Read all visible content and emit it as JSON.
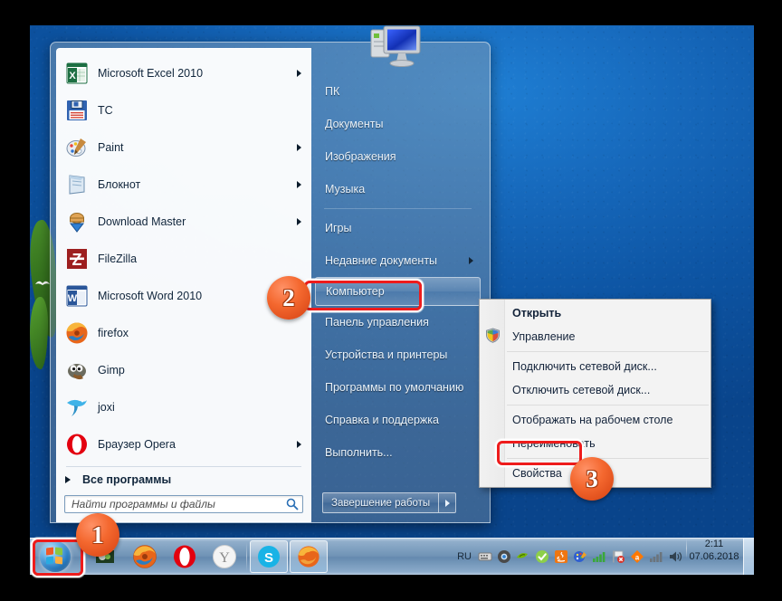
{
  "desktop": {
    "wallpaper_color": "#1668bb"
  },
  "start_menu": {
    "user_picture": "computer-monitor-icon",
    "programs": [
      {
        "label": "Microsoft Excel 2010",
        "icon": "excel-icon",
        "has_submenu": true
      },
      {
        "label": "TC",
        "icon": "total-commander-icon",
        "has_submenu": false
      },
      {
        "label": "Paint",
        "icon": "paint-icon",
        "has_submenu": true
      },
      {
        "label": "Блокнот",
        "icon": "notepad-icon",
        "has_submenu": true
      },
      {
        "label": "Download Master",
        "icon": "download-master-icon",
        "has_submenu": true
      },
      {
        "label": "FileZilla",
        "icon": "filezilla-icon",
        "has_submenu": false
      },
      {
        "label": "Microsoft Word 2010",
        "icon": "word-icon",
        "has_submenu": false
      },
      {
        "label": "firefox",
        "icon": "firefox-icon",
        "has_submenu": false
      },
      {
        "label": "Gimp",
        "icon": "gimp-icon",
        "has_submenu": false
      },
      {
        "label": "joxi",
        "icon": "joxi-icon",
        "has_submenu": false
      },
      {
        "label": "Браузер Opera",
        "icon": "opera-icon",
        "has_submenu": true
      }
    ],
    "all_programs_label": "Все программы",
    "search": {
      "placeholder": "Найти программы и файлы",
      "value": "",
      "icon": "search-icon"
    },
    "right_items": [
      {
        "label": "ПК",
        "has_submenu": false,
        "selected": false,
        "divider_after": false
      },
      {
        "label": "Документы",
        "has_submenu": false,
        "selected": false,
        "divider_after": false
      },
      {
        "label": "Изображения",
        "has_submenu": false,
        "selected": false,
        "divider_after": false
      },
      {
        "label": "Музыка",
        "has_submenu": false,
        "selected": false,
        "divider_after": true
      },
      {
        "label": "Игры",
        "has_submenu": false,
        "selected": false,
        "divider_after": false
      },
      {
        "label": "Недавние документы",
        "has_submenu": true,
        "selected": false,
        "divider_after": false
      },
      {
        "label": "Компьютер",
        "has_submenu": false,
        "selected": true,
        "divider_after": false
      },
      {
        "label": "Панель управления",
        "has_submenu": false,
        "selected": false,
        "divider_after": false
      },
      {
        "label": "Устройства и принтеры",
        "has_submenu": false,
        "selected": false,
        "divider_after": false
      },
      {
        "label": "Программы по умолчанию",
        "has_submenu": false,
        "selected": false,
        "divider_after": false
      },
      {
        "label": "Справка и поддержка",
        "has_submenu": false,
        "selected": false,
        "divider_after": false
      },
      {
        "label": "Выполнить...",
        "has_submenu": false,
        "selected": false,
        "divider_after": false
      }
    ],
    "shutdown": {
      "label": "Завершение работы",
      "more_icon": "chevron-right-icon"
    }
  },
  "context_menu": {
    "items": [
      {
        "label": "Открыть",
        "bold": true,
        "sep_after": false
      },
      {
        "label": "Управление",
        "bold": false,
        "sep_after": true,
        "shield": true
      },
      {
        "label": "Подключить сетевой диск...",
        "bold": false,
        "sep_after": false
      },
      {
        "label": "Отключить сетевой диск...",
        "bold": false,
        "sep_after": true
      },
      {
        "label": "Отображать на рабочем столе",
        "bold": false,
        "sep_after": false
      },
      {
        "label": "Переименовать",
        "bold": false,
        "sep_after": true
      },
      {
        "label": "Свойства",
        "bold": false,
        "sep_after": false,
        "highlighted": true
      }
    ]
  },
  "taskbar": {
    "start_button": "start-orb-icon",
    "pinned": [
      {
        "name": "unknown-app-icon",
        "active": false
      },
      {
        "name": "firefox-icon",
        "active": false
      },
      {
        "name": "opera-icon",
        "active": false
      },
      {
        "name": "yandex-browser-icon",
        "active": false
      },
      {
        "name": "skype-icon",
        "active": true
      },
      {
        "name": "firefox-window-icon",
        "active": true
      }
    ],
    "tray": {
      "language": "RU",
      "icons": [
        "keyboard-icon",
        "chrome-icon",
        "nvidia-icon",
        "green-check-icon",
        "java-icon",
        "paint-net-icon",
        "signal-bars-icon",
        "network-error-icon",
        "avast-icon",
        "signal-bars-2-icon",
        "volume-icon"
      ]
    },
    "clock": {
      "time": "2:11",
      "date": "07.06.2018"
    },
    "show_desktop": "show-desktop-button"
  },
  "callouts": [
    {
      "number": "1",
      "target": "start-button"
    },
    {
      "number": "2",
      "target": "computer-menu-item"
    },
    {
      "number": "3",
      "target": "properties-menu-item"
    }
  ]
}
